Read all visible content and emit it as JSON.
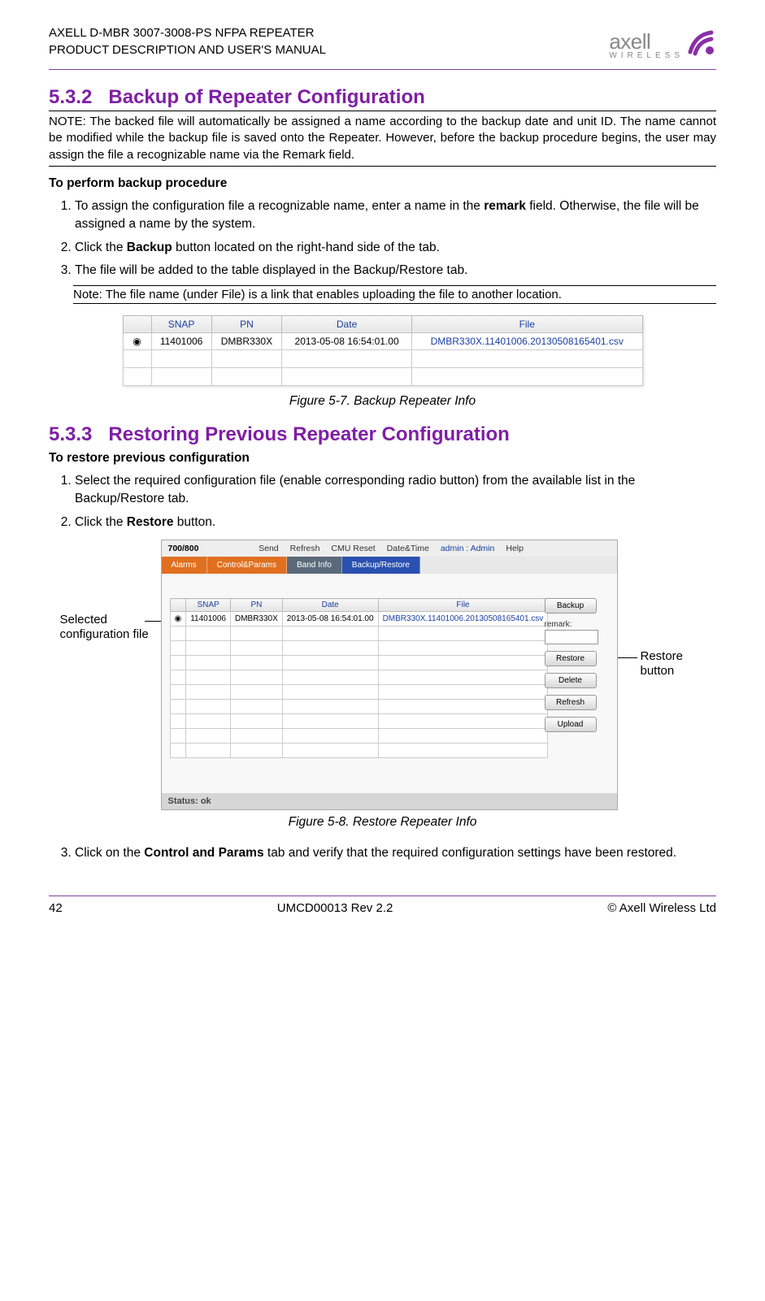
{
  "header": {
    "line1": "AXELL D-MBR 3007-3008-PS NFPA REPEATER",
    "line2": "PRODUCT DESCRIPTION AND USER'S MANUAL",
    "logo_text": "axell",
    "logo_sub": "WIRELESS"
  },
  "section1": {
    "num": "5.3.2",
    "title": "Backup of Repeater Configuration",
    "note": "NOTE: The backed file will automatically be assigned a name according to the backup date and unit ID. The name cannot be modified while the backup file is saved onto the Repeater. However, before the backup procedure begins, the user may assign the file a recognizable name via the Remark field.",
    "subheading": "To perform backup procedure",
    "step1a": "To assign the configuration file a recognizable name, enter a name in the ",
    "step1b": "remark",
    "step1c": " field. Otherwise, the file will be assigned a name by the system.",
    "step2a": "Click the ",
    "step2b": "Backup",
    "step2c": " button located on the right-hand side of the tab.",
    "step3": "The file will be added to the table displayed in the Backup/Restore tab.",
    "note_small": "Note: The file name (under File) is a link that enables uploading the file to another location."
  },
  "table1": {
    "h1": "SNAP",
    "h2": "PN",
    "h3": "Date",
    "h4": "File",
    "r1c1": "11401006",
    "r1c2": "DMBR330X",
    "r1c3": "2013-05-08 16:54:01.00",
    "r1c4": "DMBR330X.11401006.20130508165401.csv"
  },
  "fig1_caption": "Figure 5-7. Backup Repeater Info",
  "section2": {
    "num": "5.3.3",
    "title": "Restoring Previous Repeater Configuration",
    "subheading": "To restore previous configuration",
    "step1": "Select the required configuration file (enable corresponding radio button) from the available list in the Backup/Restore tab.",
    "step2a": "Click the ",
    "step2b": "Restore",
    "step2c": " button.",
    "step3a": "Click on the ",
    "step3b": "Control and Params",
    "step3c": " tab and verify that the required configuration settings have been restored."
  },
  "callout_left": "Selected configuration file",
  "callout_right": "Restore button",
  "app": {
    "name": "700/800",
    "menu": {
      "send": "Send",
      "refresh": "Refresh",
      "reset": "CMU Reset",
      "datetime": "Date&Time",
      "admin": "admin : Admin",
      "help": "Help"
    },
    "tabs": {
      "t1": "Alarms",
      "t2": "Control&Params",
      "t3": "Band Info",
      "t4": "Backup/Restore"
    },
    "btns": {
      "backup": "Backup",
      "remark": "remark:",
      "restore": "Restore",
      "delete": "Delete",
      "refresh": "Refresh",
      "upload": "Upload"
    },
    "status": "Status: ok"
  },
  "table2": {
    "h1": "SNAP",
    "h2": "PN",
    "h3": "Date",
    "h4": "File",
    "r1c1": "11401006",
    "r1c2": "DMBR330X",
    "r1c3": "2013-05-08 16:54:01.00",
    "r1c4": "DMBR330X.11401006.20130508165401.csv"
  },
  "fig2_caption": "Figure 5-8. Restore Repeater Info",
  "footer": {
    "page": "42",
    "doc": "UMCD00013 Rev 2.2",
    "copy": "© Axell Wireless Ltd"
  }
}
